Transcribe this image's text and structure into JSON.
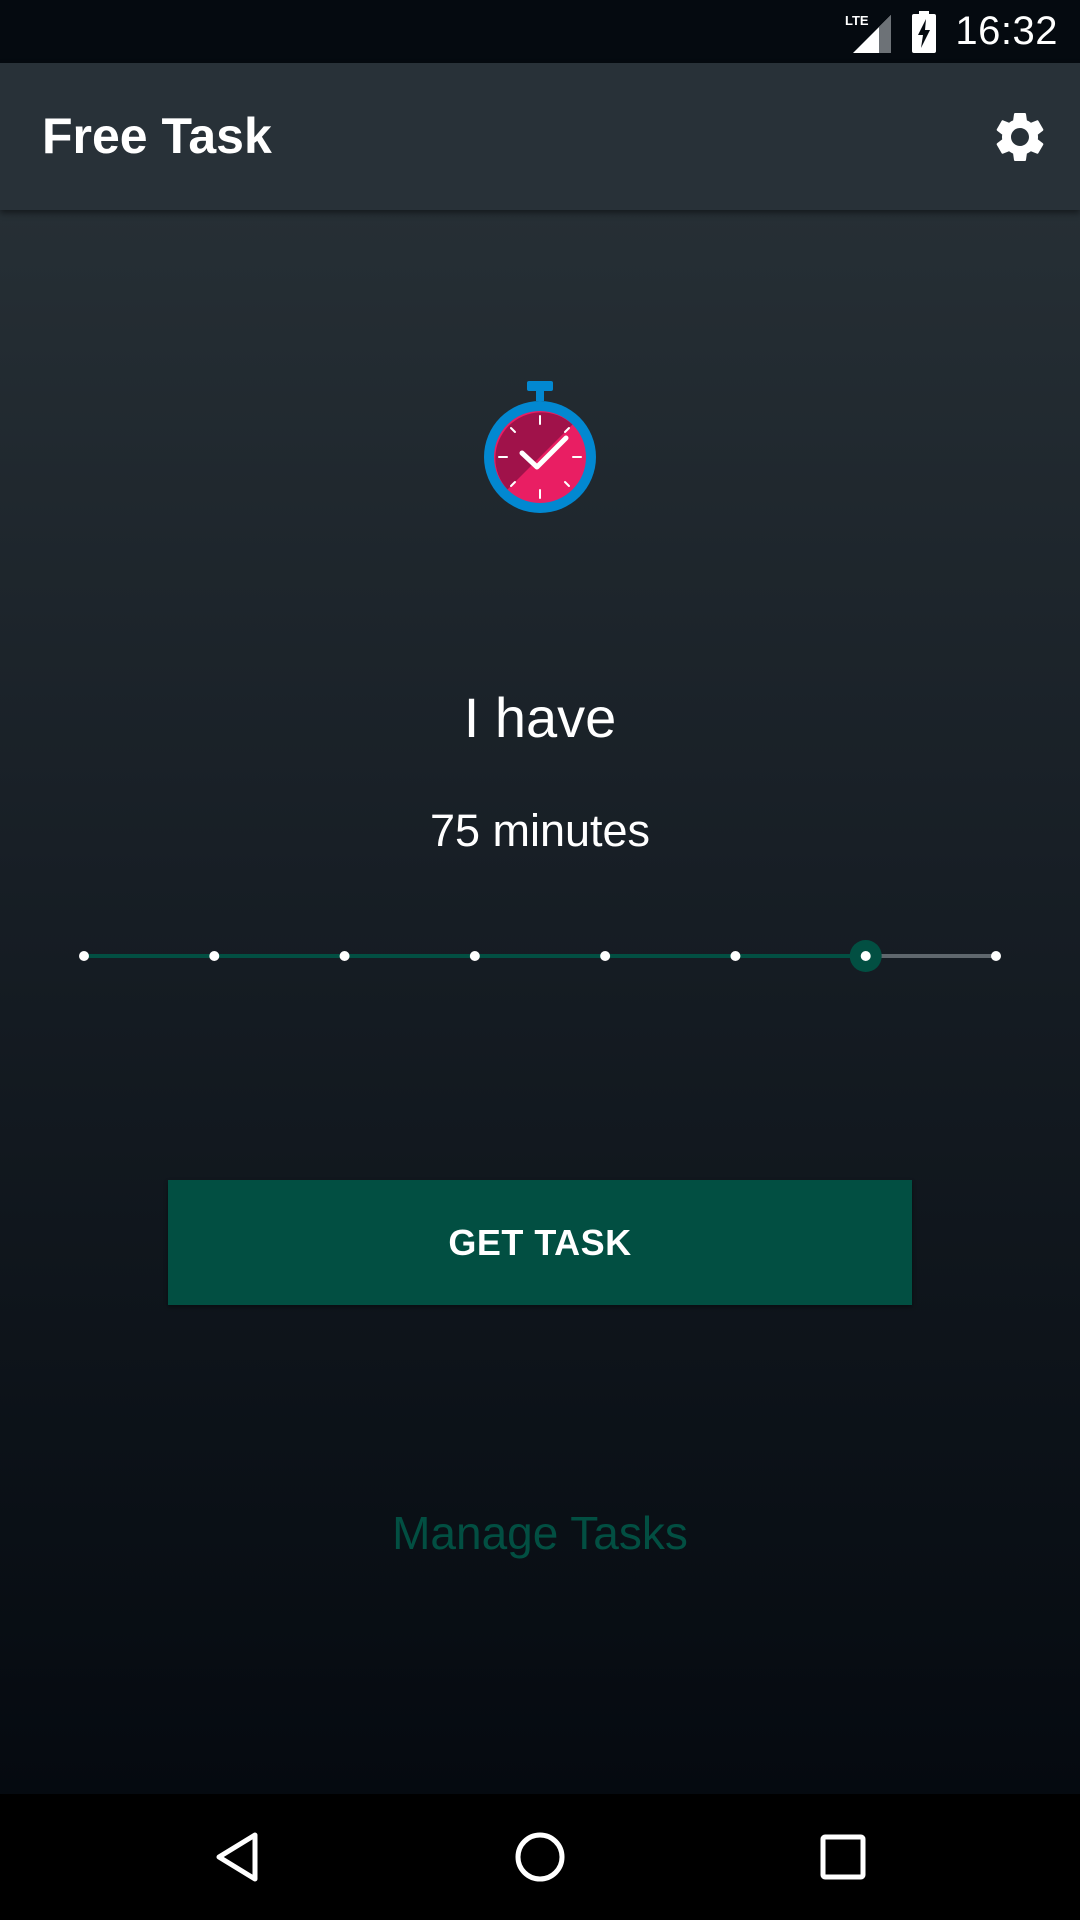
{
  "status_bar": {
    "time": "16:32",
    "network_label": "LTE",
    "icons": [
      "lte-signal-icon",
      "battery-charging-icon"
    ]
  },
  "app_bar": {
    "title": "Free Task",
    "settings_icon": "gear-icon"
  },
  "main": {
    "illustration_icon": "stopwatch-icon",
    "headline": "I have",
    "duration_text": "75 minutes",
    "slider": {
      "steps": 8,
      "selected_step": 6
    },
    "primary_button": "GET TASK",
    "secondary_link": "Manage Tasks"
  },
  "nav_bar": {
    "icons": [
      "back-icon",
      "home-icon",
      "recents-icon"
    ]
  },
  "colors": {
    "accent": "#024f42",
    "app_bar": "#283138",
    "stopwatch_face": "#e91e63",
    "stopwatch_face_dark": "#a0124a",
    "stopwatch_ring": "#0288d1",
    "slider_inactive": "#5f676d"
  }
}
